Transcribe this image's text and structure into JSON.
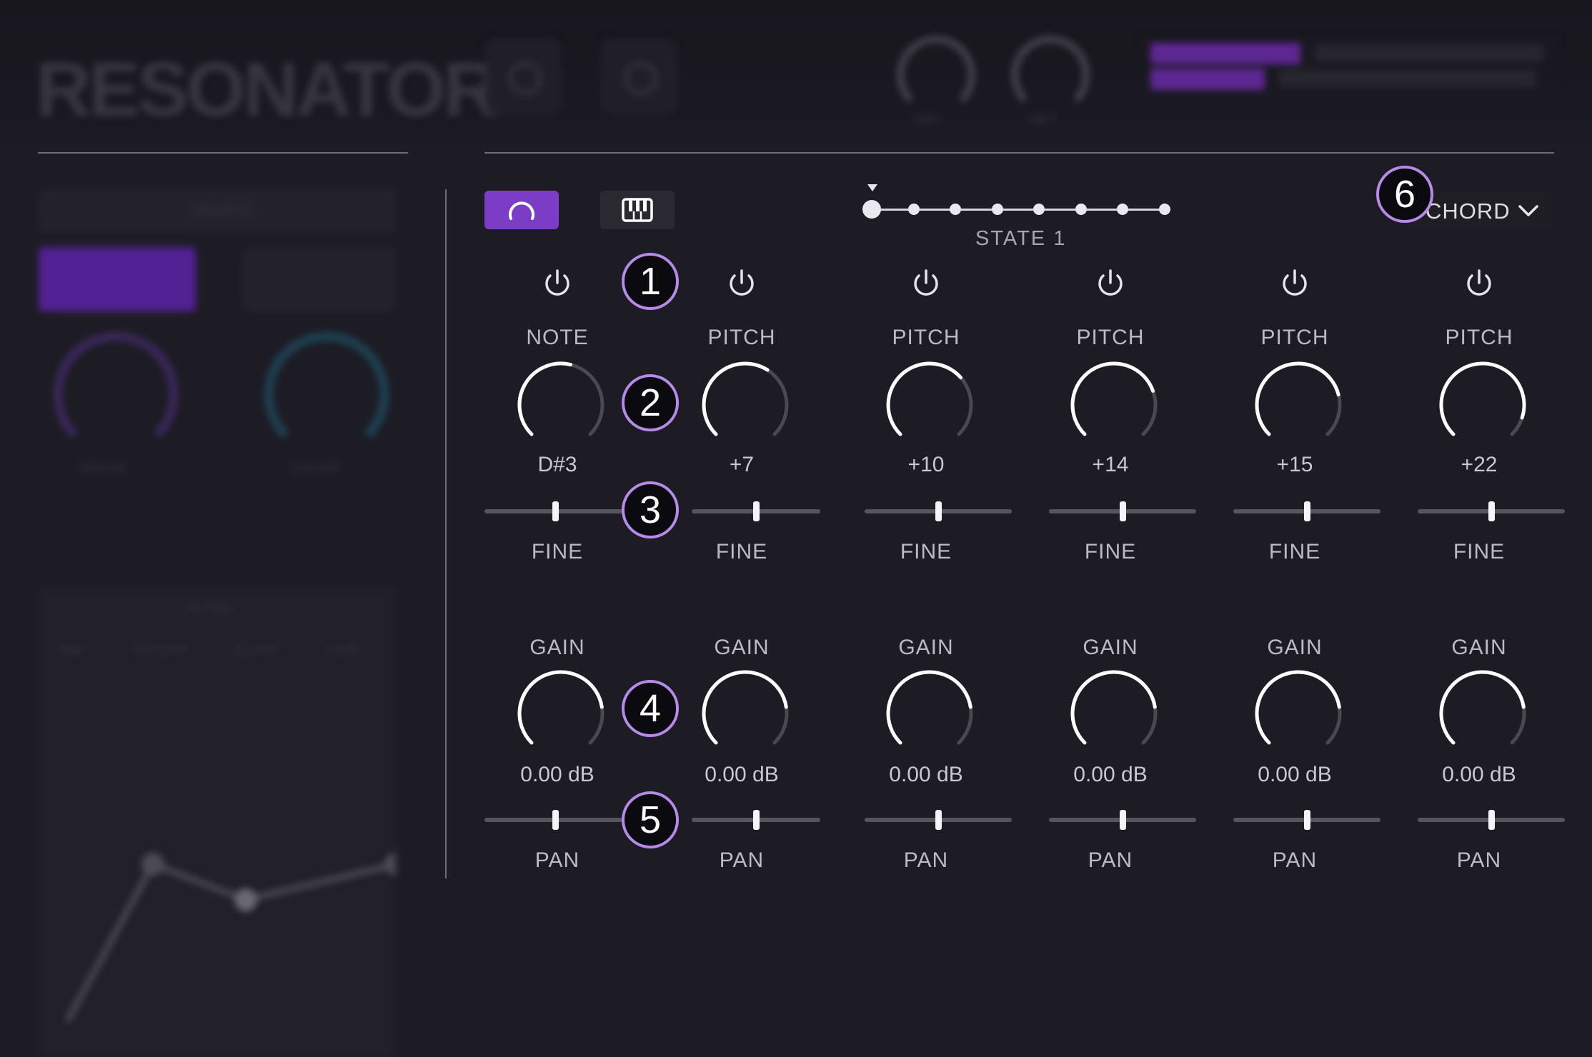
{
  "header": {
    "logo": "RESONATOR",
    "knob_labels": [
      "DRY",
      "WET"
    ]
  },
  "left_panel": {
    "section_title": "SOURCE",
    "knob_labels": [
      "DECAY",
      "COLOR"
    ],
    "filter_title": "FILTER",
    "filter_tabs": [
      "BW",
      "CUTOFF",
      "SLOPE",
      "TYPE"
    ]
  },
  "mode_buttons": [
    {
      "name": "resonator-mode",
      "icon": "arc-icon",
      "active": true
    },
    {
      "name": "keys-mode",
      "icon": "piano-icon",
      "active": false
    }
  ],
  "sequencer": {
    "steps": 8,
    "current_step": 1,
    "state_label": "STATE  1"
  },
  "chord_dropdown": {
    "selected": "CHORD",
    "icon": "chevron-down-icon"
  },
  "callouts": [
    "1",
    "2",
    "3",
    "4",
    "5",
    "6"
  ],
  "voices": [
    {
      "pitch_label": "NOTE",
      "pitch_value": "D#3",
      "pitch_level": 0.55,
      "fine_label": "FINE",
      "fine_level": 0.5,
      "gain_label": "GAIN",
      "gain_value": "0.00 dB",
      "gain_level": 0.8,
      "pan_label": "PAN",
      "pan_level": 0.5
    },
    {
      "pitch_label": "PITCH",
      "pitch_value": "+7",
      "pitch_level": 0.62,
      "fine_label": "FINE",
      "fine_level": 0.5,
      "gain_label": "GAIN",
      "gain_value": "0.00 dB",
      "gain_level": 0.8,
      "pan_label": "PAN",
      "pan_level": 0.5
    },
    {
      "pitch_label": "PITCH",
      "pitch_value": "+10",
      "pitch_level": 0.68,
      "fine_label": "FINE",
      "fine_level": 0.5,
      "gain_label": "GAIN",
      "gain_value": "0.00 dB",
      "gain_level": 0.8,
      "pan_label": "PAN",
      "pan_level": 0.5
    },
    {
      "pitch_label": "PITCH",
      "pitch_value": "+14",
      "pitch_level": 0.76,
      "fine_label": "FINE",
      "fine_level": 0.5,
      "gain_label": "GAIN",
      "gain_value": "0.00 dB",
      "gain_level": 0.8,
      "pan_label": "PAN",
      "pan_level": 0.5
    },
    {
      "pitch_label": "PITCH",
      "pitch_value": "+15",
      "pitch_level": 0.78,
      "fine_label": "FINE",
      "fine_level": 0.5,
      "gain_label": "GAIN",
      "gain_value": "0.00 dB",
      "gain_level": 0.8,
      "pan_label": "PAN",
      "pan_level": 0.5
    },
    {
      "pitch_label": "PITCH",
      "pitch_value": "+22",
      "pitch_level": 0.9,
      "fine_label": "FINE",
      "fine_level": 0.5,
      "gain_label": "GAIN",
      "gain_value": "0.00 dB",
      "gain_level": 0.8,
      "pan_label": "PAN",
      "pan_level": 0.5
    }
  ],
  "colors": {
    "accent": "#7b3cc6",
    "callout_border": "#b68ae8",
    "knob_arc": "#ffffff",
    "knob_track": "#4a4950"
  }
}
